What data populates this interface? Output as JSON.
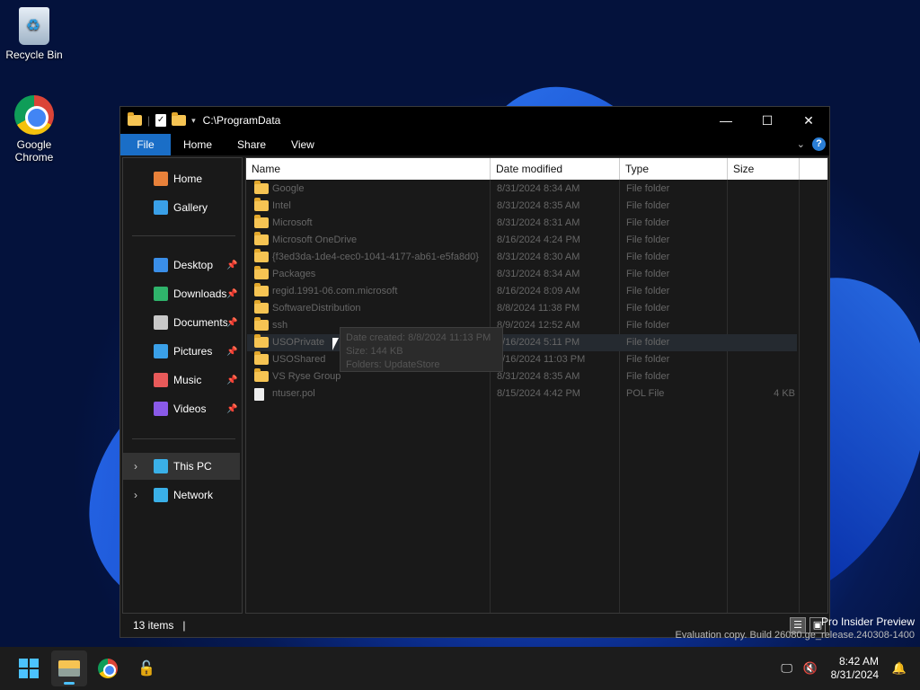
{
  "desktop": {
    "icons": [
      {
        "label": "Recycle Bin"
      },
      {
        "label": "Google Chrome"
      }
    ],
    "watermark": {
      "line1": "Pro Insider Preview",
      "line2": "Evaluation copy. Build 26080.ge_release.240308-1400"
    }
  },
  "window": {
    "title": "C:\\ProgramData",
    "controls": {
      "minimize": "—",
      "maximize": "☐",
      "close": "✕"
    },
    "ribbon": {
      "tabs": [
        "File",
        "Home",
        "Share",
        "View"
      ]
    },
    "nav": {
      "items": [
        {
          "label": "Home",
          "icon": "home-icon",
          "color": "#e8813a"
        },
        {
          "label": "Gallery",
          "icon": "gallery-icon",
          "color": "#3aa0e8"
        },
        {
          "label": "Desktop",
          "icon": "desktop-icon",
          "color": "#3a8ee8",
          "pinned": true
        },
        {
          "label": "Downloads",
          "icon": "downloads-icon",
          "color": "#2fb36b",
          "pinned": true
        },
        {
          "label": "Documents",
          "icon": "documents-icon",
          "color": "#c8c8c8",
          "pinned": true
        },
        {
          "label": "Pictures",
          "icon": "pictures-icon",
          "color": "#3aa0e8",
          "pinned": true
        },
        {
          "label": "Music",
          "icon": "music-icon",
          "color": "#e85a5a",
          "pinned": true
        },
        {
          "label": "Videos",
          "icon": "videos-icon",
          "color": "#8a5ae8",
          "pinned": true
        },
        {
          "label": "This PC",
          "icon": "this-pc-icon",
          "color": "#3ab0e8",
          "expandable": true,
          "selected": true
        },
        {
          "label": "Network",
          "icon": "network-icon",
          "color": "#3ab0e8",
          "expandable": true
        }
      ]
    },
    "columns": [
      "Name",
      "Date modified",
      "Type",
      "Size"
    ],
    "rows": [
      {
        "name": "Google",
        "date": "8/31/2024 8:34 AM",
        "type": "File folder",
        "size": "",
        "kind": "folder"
      },
      {
        "name": "Intel",
        "date": "8/31/2024 8:35 AM",
        "type": "File folder",
        "size": "",
        "kind": "folder"
      },
      {
        "name": "Microsoft",
        "date": "8/31/2024 8:31 AM",
        "type": "File folder",
        "size": "",
        "kind": "folder"
      },
      {
        "name": "Microsoft OneDrive",
        "date": "8/16/2024 4:24 PM",
        "type": "File folder",
        "size": "",
        "kind": "folder"
      },
      {
        "name": "{f3ed3da-1de4-cec0-1041-4177-ab61-e5fa8d0}",
        "date": "8/31/2024 8:30 AM",
        "type": "File folder",
        "size": "",
        "kind": "folder"
      },
      {
        "name": "Packages",
        "date": "8/31/2024 8:34 AM",
        "type": "File folder",
        "size": "",
        "kind": "folder"
      },
      {
        "name": "regid.1991-06.com.microsoft",
        "date": "8/16/2024 8:09 AM",
        "type": "File folder",
        "size": "",
        "kind": "folder"
      },
      {
        "name": "SoftwareDistribution",
        "date": "8/8/2024 11:38 PM",
        "type": "File folder",
        "size": "",
        "kind": "folder"
      },
      {
        "name": "ssh",
        "date": "8/9/2024 12:52 AM",
        "type": "File folder",
        "size": "",
        "kind": "folder"
      },
      {
        "name": "USOPrivate",
        "date": "8/16/2024 5:11 PM",
        "type": "File folder",
        "size": "",
        "kind": "folder",
        "hover": true
      },
      {
        "name": "USOShared",
        "date": "8/16/2024 11:03 PM",
        "type": "File folder",
        "size": "",
        "kind": "folder"
      },
      {
        "name": "VS Ryse Group",
        "date": "8/31/2024 8:35 AM",
        "type": "File folder",
        "size": "",
        "kind": "folder"
      },
      {
        "name": "ntuser.pol",
        "date": "8/15/2024 4:42 PM",
        "type": "POL File",
        "size": "4 KB",
        "kind": "file"
      }
    ],
    "tooltip": {
      "line1": "Date created: 8/8/2024 11:13 PM",
      "line2": "Size: 144 KB",
      "line3": "Folders: UpdateStore"
    },
    "status": {
      "count": "13 items",
      "separator": "|"
    }
  },
  "taskbar": {
    "time": "8:42 AM",
    "date": "8/31/2024"
  },
  "colors": {
    "accent": "#1a6ec7",
    "taskbar_indicator": "#4cc2ff"
  }
}
